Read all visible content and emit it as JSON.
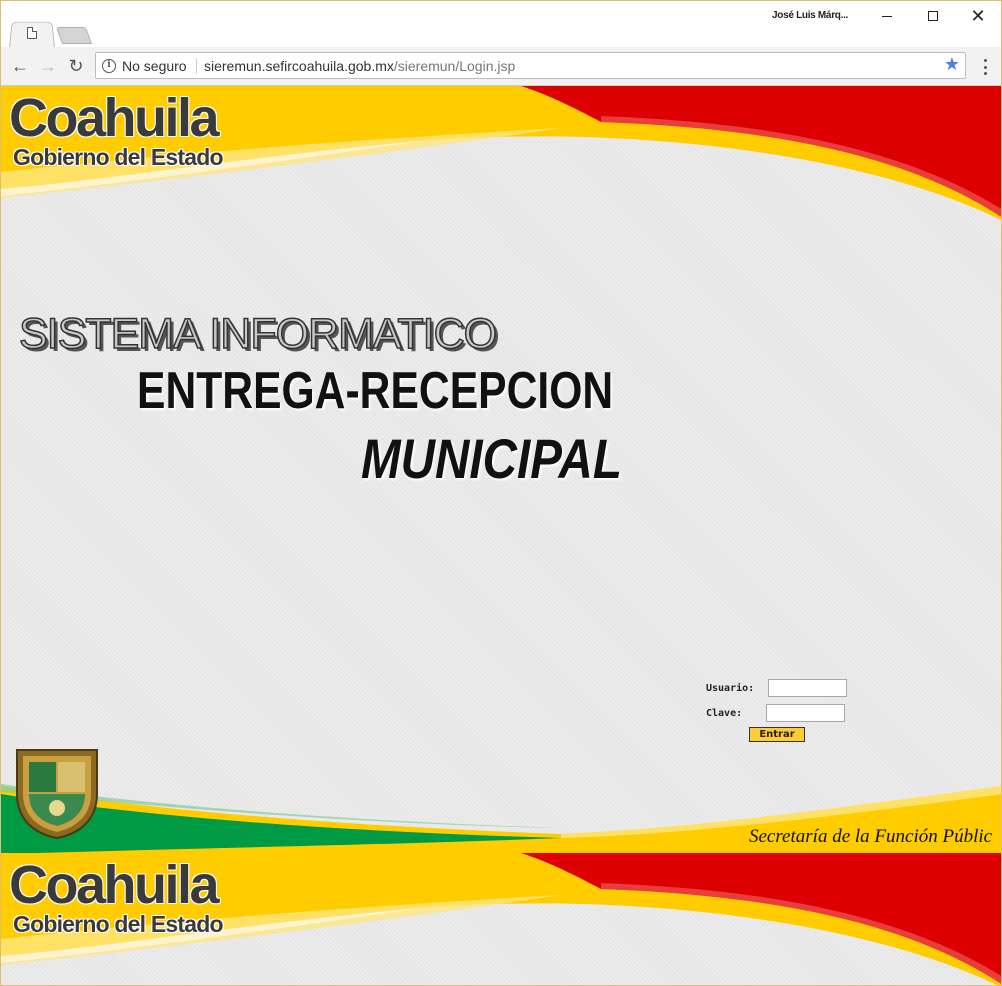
{
  "browser": {
    "profile_name": "José Luis Márq...",
    "security_label": "No seguro",
    "url_host": "sieremun.sefircoahuila.gob.mx",
    "url_path": "/sieremun/Login.jsp"
  },
  "branding": {
    "logo_main": "Coahuila",
    "logo_sub": "Gobierno del Estado",
    "colors": {
      "red": "#dd0000",
      "yellow": "#ffcc00",
      "green": "#009944"
    }
  },
  "hero": {
    "line1": "SISTEMA INFORMATICO",
    "line2": "ENTREGA-RECEPCION",
    "line3": "MUNICIPAL"
  },
  "login": {
    "user_label": "Usuario:",
    "password_label": "Clave:",
    "submit_label": "Entrar"
  },
  "footer": {
    "department": "Secretaría de la Función Públic"
  }
}
